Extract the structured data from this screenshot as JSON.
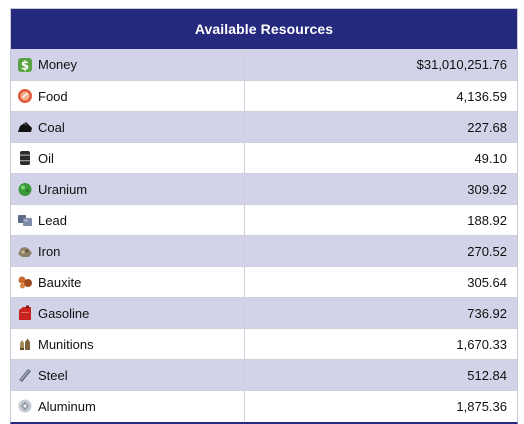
{
  "table": {
    "title": "Available Resources",
    "rows": [
      {
        "label": "Money",
        "value": "$31,010,251.76",
        "icon": "money-icon"
      },
      {
        "label": "Food",
        "value": "4,136.59",
        "icon": "food-icon"
      },
      {
        "label": "Coal",
        "value": "227.68",
        "icon": "coal-icon"
      },
      {
        "label": "Oil",
        "value": "49.10",
        "icon": "oil-icon"
      },
      {
        "label": "Uranium",
        "value": "309.92",
        "icon": "uranium-icon"
      },
      {
        "label": "Lead",
        "value": "188.92",
        "icon": "lead-icon"
      },
      {
        "label": "Iron",
        "value": "270.52",
        "icon": "iron-icon"
      },
      {
        "label": "Bauxite",
        "value": "305.64",
        "icon": "bauxite-icon"
      },
      {
        "label": "Gasoline",
        "value": "736.92",
        "icon": "gasoline-icon"
      },
      {
        "label": "Munitions",
        "value": "1,670.33",
        "icon": "munitions-icon"
      },
      {
        "label": "Steel",
        "value": "512.84",
        "icon": "steel-icon"
      },
      {
        "label": "Aluminum",
        "value": "1,875.36",
        "icon": "aluminum-icon"
      }
    ]
  },
  "colors": {
    "header_bg": "#262a7e",
    "row_alt_bg": "#d2d3e8"
  }
}
